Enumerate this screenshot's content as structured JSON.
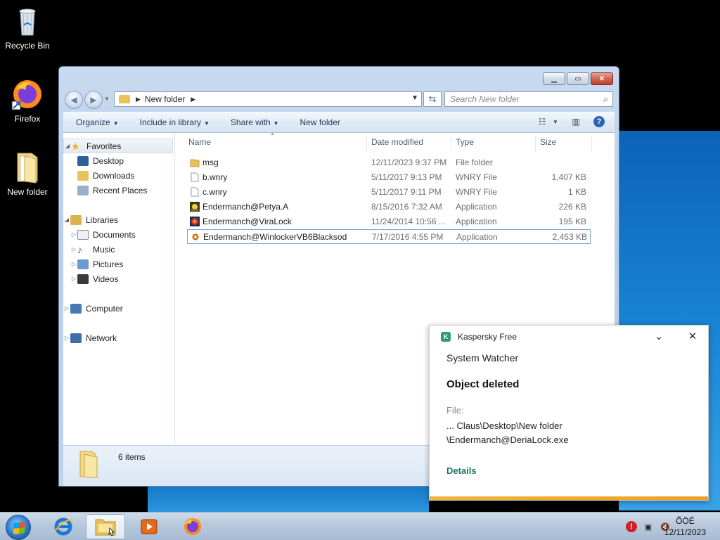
{
  "desktop": {
    "icons": [
      {
        "label": "Recycle Bin",
        "icon": "recycle-bin-icon"
      },
      {
        "label": "Firefox",
        "icon": "firefox-icon"
      },
      {
        "label": "New folder",
        "icon": "folder-icon"
      }
    ]
  },
  "explorer": {
    "breadcrumb": "New folder",
    "search_placeholder": "Search New folder",
    "toolbar": {
      "organize": "Organize",
      "include": "Include in library",
      "share": "Share with",
      "new_folder": "New folder"
    },
    "nav": {
      "favorites": "Favorites",
      "desktop": "Desktop",
      "downloads": "Downloads",
      "recent": "Recent Places",
      "libraries": "Libraries",
      "documents": "Documents",
      "music": "Music",
      "pictures": "Pictures",
      "videos": "Videos",
      "computer": "Computer",
      "network": "Network"
    },
    "columns": {
      "name": "Name",
      "date": "Date modified",
      "type": "Type",
      "size": "Size"
    },
    "files": [
      {
        "name": "msg",
        "date": "12/11/2023 9:37 PM",
        "type": "File folder",
        "size": "",
        "icon": "folder-icon"
      },
      {
        "name": "b.wnry",
        "date": "5/11/2017 9:13 PM",
        "type": "WNRY File",
        "size": "1,407 KB",
        "icon": "file-icon"
      },
      {
        "name": "c.wnry",
        "date": "5/11/2017 9:11 PM",
        "type": "WNRY File",
        "size": "1 KB",
        "icon": "file-icon"
      },
      {
        "name": "Endermanch@Petya.A",
        "date": "8/15/2016 7:32 AM",
        "type": "Application",
        "size": "226 KB",
        "icon": "petya-icon"
      },
      {
        "name": "Endermanch@ViraLock",
        "date": "11/24/2014 10:56 ...",
        "type": "Application",
        "size": "195 KB",
        "icon": "viralock-icon"
      },
      {
        "name": "Endermanch@WinlockerVB6Blacksod",
        "date": "7/17/2016 4:55 PM",
        "type": "Application",
        "size": "2,453 KB",
        "icon": "gear-icon"
      }
    ],
    "status": "6 items"
  },
  "kaspersky": {
    "app": "Kaspersky Free",
    "component": "System Watcher",
    "headline": "Object deleted",
    "file_label": "File:",
    "path_line1": "... Claus\\Desktop\\New folder",
    "path_line2": "\\Endermanch@DeriaLock.exe",
    "details": "Details",
    "accent": "#1a7a63"
  },
  "taskbar": {
    "clock_time": "ÕÖÉ",
    "clock_date": "12/11/2023"
  }
}
